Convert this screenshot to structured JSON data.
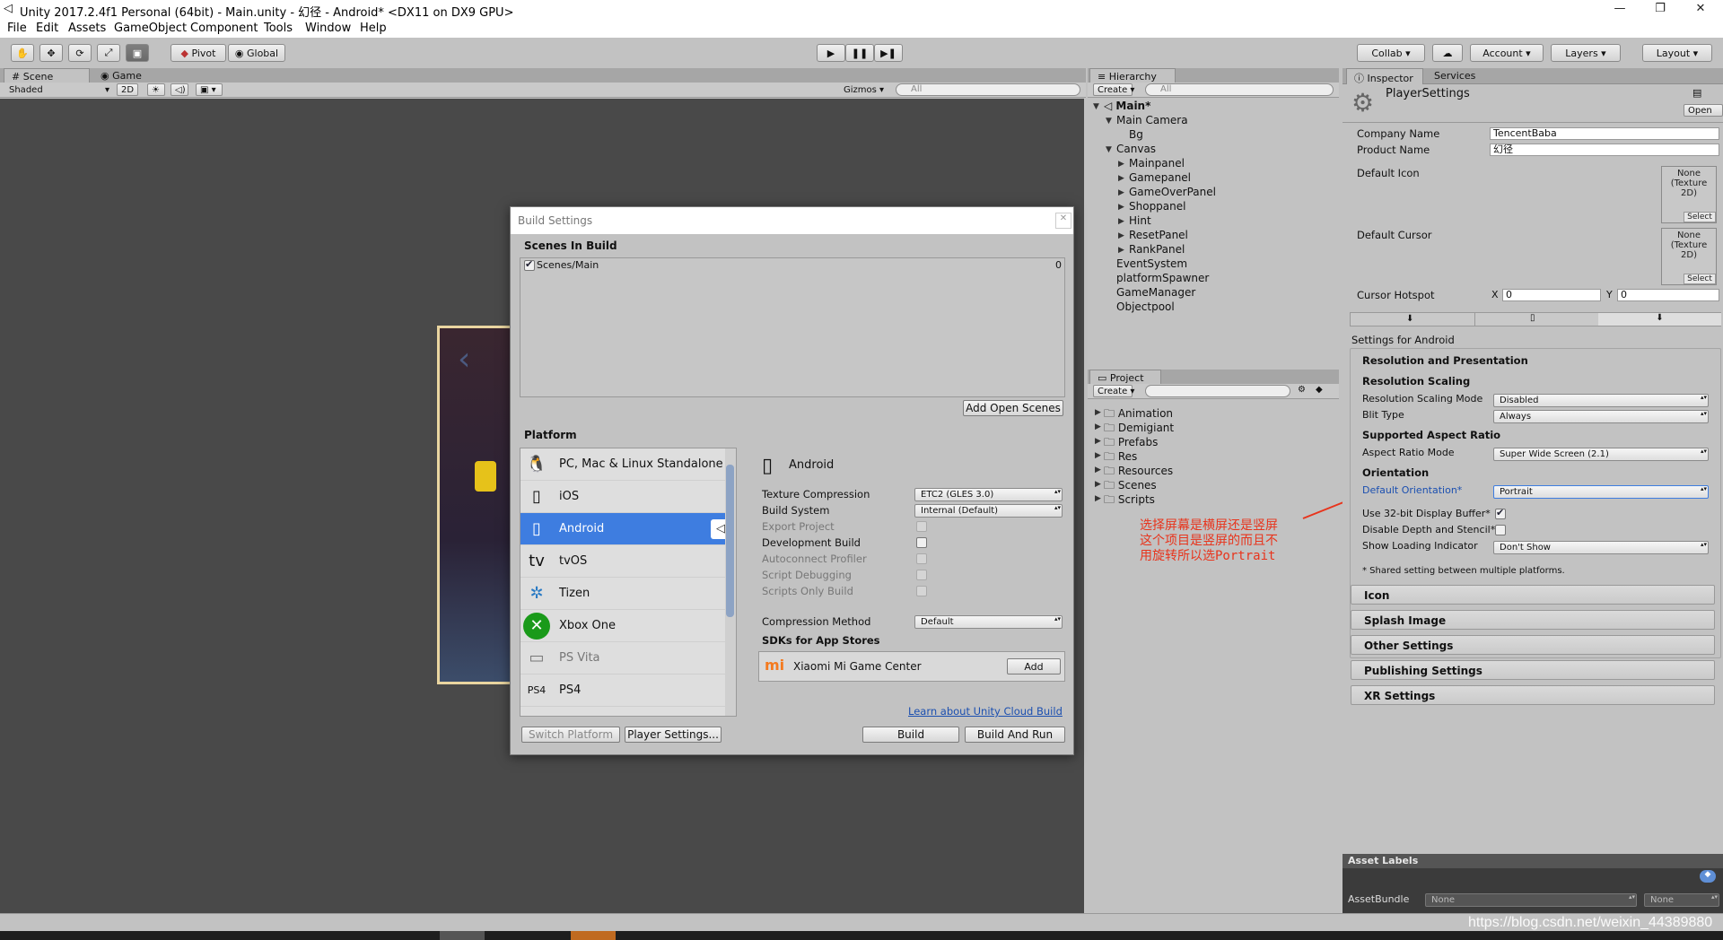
{
  "window": {
    "title": "Unity 2017.2.4f1 Personal (64bit) - Main.unity - 幻径 - Android* <DX11 on DX9 GPU>"
  },
  "menu": [
    "File",
    "Edit",
    "Assets",
    "GameObject",
    "Component",
    "Tools",
    "Window",
    "Help"
  ],
  "toolbar": {
    "pivot": "Pivot",
    "global": "Global",
    "collab": "Collab ▾",
    "account": "Account",
    "layers": "Layers",
    "layout": "Layout"
  },
  "scene": {
    "tab_scene": "Scene",
    "tab_game": "Game",
    "shading": "Shaded",
    "mode2d": "2D",
    "gizmos": "Gizmos ▾",
    "search": "All"
  },
  "hierarchy": {
    "tab": "Hierarchy",
    "create": "Create ▾",
    "search": "All",
    "root": "Main*",
    "items": [
      {
        "label": "Main Camera"
      },
      {
        "label": "Bg"
      },
      {
        "label": "Canvas"
      },
      {
        "label": "Mainpanel"
      },
      {
        "label": "Gamepanel"
      },
      {
        "label": "GameOverPanel"
      },
      {
        "label": "Shoppanel"
      },
      {
        "label": "Hint"
      },
      {
        "label": "ResetPanel"
      },
      {
        "label": "RankPanel"
      },
      {
        "label": "EventSystem"
      },
      {
        "label": "platformSpawner"
      },
      {
        "label": "GameManager"
      },
      {
        "label": "Objectpool"
      }
    ]
  },
  "project": {
    "tab": "Project",
    "create": "Create ▾",
    "folders": [
      "Animation",
      "Demigiant",
      "Prefabs",
      "Res",
      "Resources",
      "Scenes",
      "Scripts"
    ]
  },
  "build": {
    "title": "Build Settings",
    "scenes_header": "Scenes In Build",
    "scene_entry": "Scenes/Main",
    "scene_index": "0",
    "add_open_scenes": "Add Open Scenes",
    "platform_header": "Platform",
    "platforms": [
      {
        "label": "PC, Mac & Linux Standalone"
      },
      {
        "label": "iOS"
      },
      {
        "label": "Android"
      },
      {
        "label": "tvOS"
      },
      {
        "label": "Tizen"
      },
      {
        "label": "Xbox One"
      },
      {
        "label": "PS Vita"
      },
      {
        "label": "PS4"
      }
    ],
    "selected_platform": "Android",
    "texture_compression_label": "Texture Compression",
    "texture_compression": "ETC2 (GLES 3.0)",
    "build_system_label": "Build System",
    "build_system": "Internal (Default)",
    "export_project": "Export Project",
    "development_build": "Development Build",
    "autoconnect_profiler": "Autoconnect Profiler",
    "script_debugging": "Script Debugging",
    "scripts_only_build": "Scripts Only Build",
    "compression_label": "Compression Method",
    "compression": "Default",
    "sdks_header": "SDKs for App Stores",
    "sdk_name": "Xiaomi Mi Game Center",
    "sdk_add": "Add",
    "cloud_link": "Learn about Unity Cloud Build",
    "switch_platform": "Switch Platform",
    "player_settings": "Player Settings...",
    "build": "Build",
    "build_and_run": "Build And Run"
  },
  "inspector": {
    "tab": "Inspector",
    "tab2": "Services",
    "object": "PlayerSettings",
    "open": "Open",
    "company_label": "Company Name",
    "company": "TencentBaba",
    "product_label": "Product Name",
    "product": "幻径",
    "default_icon": "Default Icon",
    "default_cursor": "Default Cursor",
    "texture_none": "None (Texture 2D)",
    "select": "Select",
    "hotspot_label": "Cursor Hotspot",
    "hx_label": "X",
    "hx": "0",
    "hy_label": "Y",
    "hy": "0",
    "settings_for": "Settings for Android",
    "res_header": "Resolution and Presentation",
    "res_scaling": "Resolution Scaling",
    "res_scaling_mode_label": "Resolution Scaling Mode",
    "res_scaling_mode": "Disabled",
    "blit_label": "Blit Type",
    "blit": "Always",
    "aspect_header": "Supported Aspect Ratio",
    "aspect_mode_label": "Aspect Ratio Mode",
    "aspect_mode": "Super Wide Screen (2.1)",
    "orientation_header": "Orientation",
    "orientation_label": "Default Orientation*",
    "orientation": "Portrait",
    "use32_label": "Use 32-bit Display Buffer*",
    "disable_depth_label": "Disable Depth and Stencil*",
    "loading_label": "Show Loading Indicator",
    "loading": "Don't Show",
    "shared_note": "* Shared setting between multiple platforms.",
    "sections": [
      "Icon",
      "Splash Image",
      "Other Settings",
      "Publishing Settings",
      "XR Settings"
    ],
    "asset_labels": "Asset Labels",
    "asset_bundle": "AssetBundle",
    "bundle_none": "None",
    "variant_none": "None"
  },
  "annotation": {
    "line1": "选择屏幕是横屏还是竖屏",
    "line2": "这个项目是竖屏的而且不",
    "line3": "用旋转所以选Portrait",
    "color": "#e8341c"
  },
  "watermark": "https://blog.csdn.net/weixin_44389880"
}
